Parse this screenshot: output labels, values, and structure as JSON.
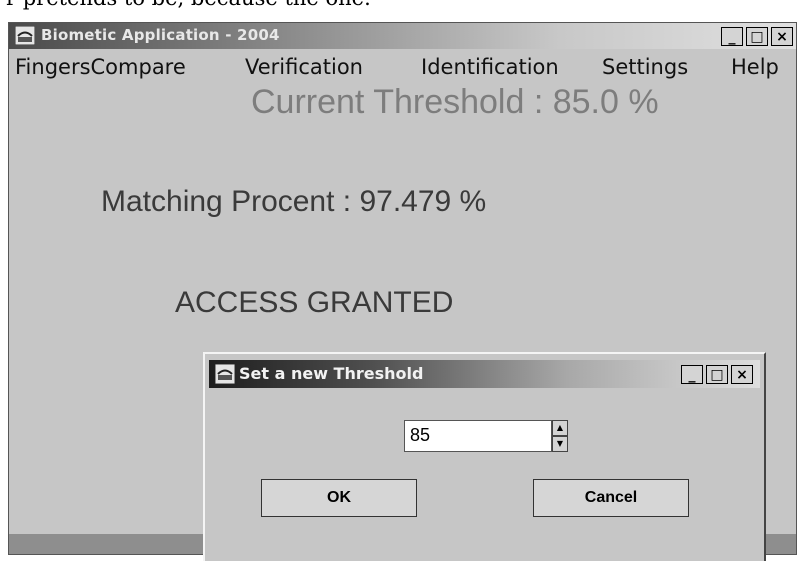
{
  "document": {
    "partial_text": "r pretends to be, because the        one."
  },
  "main_window": {
    "title": "Biometic Application - 2004",
    "controls": {
      "minimize": "_",
      "maximize": "□",
      "close": "×"
    },
    "menu": [
      {
        "label": "FingersCompare",
        "mnemonic": "F"
      },
      {
        "label": "Verification",
        "mnemonic": "V"
      },
      {
        "label": "Identification",
        "mnemonic": "I"
      },
      {
        "label": "Settings",
        "mnemonic": "t"
      },
      {
        "label": "Help",
        "mnemonic": "H"
      }
    ],
    "current_threshold": "Current Threshold : 85.0 %",
    "matching_percent": "Matching Procent : 97.479 %",
    "access_status": "ACCESS GRANTED"
  },
  "dialog": {
    "title": "Set a new Threshold",
    "controls": {
      "minimize": "_",
      "maximize": "□",
      "close": "×"
    },
    "threshold_value": "85",
    "ok_label": "OK",
    "cancel_label": "Cancel"
  },
  "colors": {
    "window_bg": "#c6c6c6",
    "threshold_text": "#7d7d7d",
    "status_text": "#3a3a3a"
  }
}
